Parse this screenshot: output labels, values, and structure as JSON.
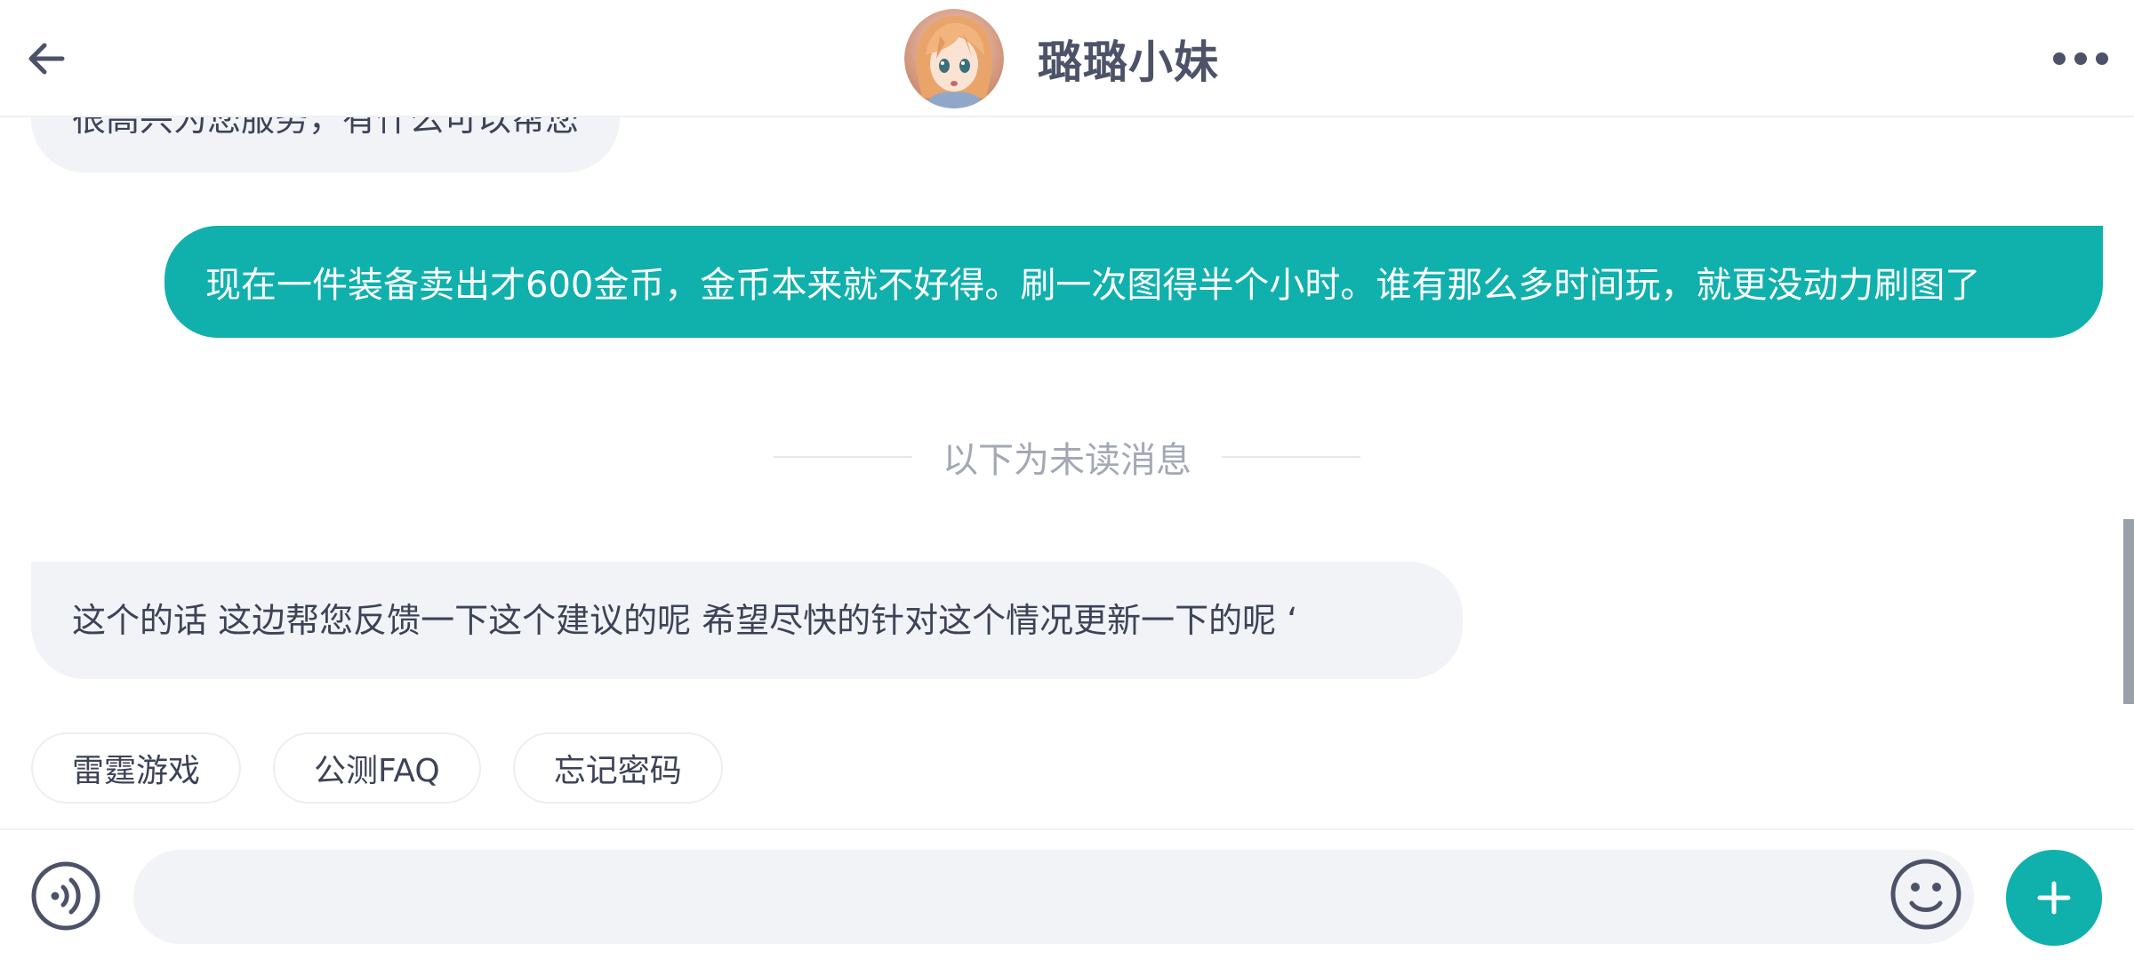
{
  "header": {
    "title": "璐璐小妹",
    "back_icon": "arrow-left-icon",
    "more_icon": "more-horizontal-icon"
  },
  "messages": {
    "previous_agent_text": "很高兴为您服务，有什么可以帮您",
    "user_text": "现在一件装备卖出才600金币，金币本来就不好得。刷一次图得半个小时。谁有那么多时间玩，就更没动力刷图了",
    "unread_divider": "以下为未读消息",
    "agent_reply": "这个的话 这边帮您反馈一下这个建议的呢 希望尽快的针对这个情况更新一下的呢 ‘"
  },
  "quick_replies": [
    "雷霆游戏",
    "公测FAQ",
    "忘记密码"
  ],
  "input": {
    "placeholder": "",
    "value": ""
  },
  "icons": {
    "voice": "voice-icon",
    "emoji": "emoji-icon",
    "plus": "plus-icon"
  },
  "colors": {
    "accent": "#10b0ad",
    "bubble_incoming": "#f1f3f7",
    "text_primary": "#3d4357",
    "text_muted": "#a3a8b5"
  }
}
